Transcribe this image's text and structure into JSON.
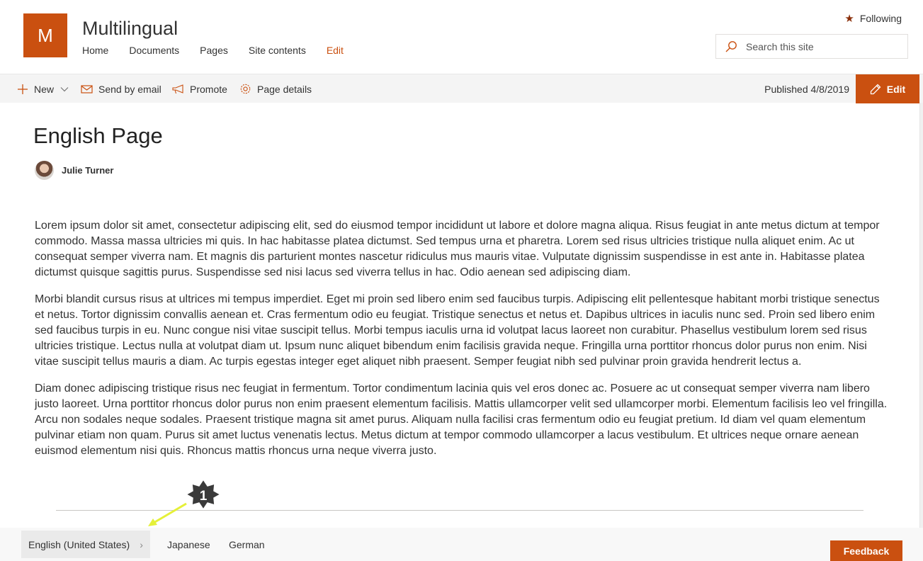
{
  "site": {
    "logo_letter": "M",
    "title": "Multilingual",
    "nav": [
      "Home",
      "Documents",
      "Pages",
      "Site contents"
    ],
    "nav_edit": "Edit",
    "following": "Following",
    "search_placeholder": "Search this site"
  },
  "command_bar": {
    "new": "New",
    "send_by_email": "Send by email",
    "promote": "Promote",
    "page_details": "Page details",
    "published": "Published 4/8/2019",
    "edit": "Edit"
  },
  "page": {
    "title": "English Page",
    "author": "Julie Turner",
    "paragraphs": [
      "Lorem ipsum dolor sit amet, consectetur adipiscing elit, sed do eiusmod tempor incididunt ut labore et dolore magna aliqua. Risus feugiat in ante metus dictum at tempor commodo. Massa massa ultricies mi quis. In hac habitasse platea dictumst. Sed tempus urna et pharetra. Lorem sed risus ultricies tristique nulla aliquet enim. Ac ut consequat semper viverra nam. Et magnis dis parturient montes nascetur ridiculus mus mauris vitae. Vulputate dignissim suspendisse in est ante in. Habitasse platea dictumst quisque sagittis purus. Suspendisse sed nisi lacus sed viverra tellus in hac. Odio aenean sed adipiscing diam.",
      "Morbi blandit cursus risus at ultrices mi tempus imperdiet. Eget mi proin sed libero enim sed faucibus turpis. Adipiscing elit pellentesque habitant morbi tristique senectus et netus. Tortor dignissim convallis aenean et. Cras fermentum odio eu feugiat. Tristique senectus et netus et. Dapibus ultrices in iaculis nunc sed. Proin sed libero enim sed faucibus turpis in eu. Nunc congue nisi vitae suscipit tellus. Morbi tempus iaculis urna id volutpat lacus laoreet non curabitur. Phasellus vestibulum lorem sed risus ultricies tristique. Lectus nulla at volutpat diam ut. Ipsum nunc aliquet bibendum enim facilisis gravida neque. Fringilla urna porttitor rhoncus dolor purus non enim. Nisi vitae suscipit tellus mauris a diam. Ac turpis egestas integer eget aliquet nibh praesent. Semper feugiat nibh sed pulvinar proin gravida hendrerit lectus a.",
      "Diam donec adipiscing tristique risus nec feugiat in fermentum. Tortor condimentum lacinia quis vel eros donec ac. Posuere ac ut consequat semper viverra nam libero justo laoreet. Urna porttitor rhoncus dolor purus non enim praesent elementum facilisis. Mattis ullamcorper velit sed ullamcorper morbi. Elementum facilisis leo vel fringilla. Arcu non sodales neque sodales. Praesent tristique magna sit amet purus. Aliquam nulla facilisi cras fermentum odio eu feugiat pretium. Id diam vel quam elementum pulvinar etiam non quam. Purus sit amet luctus venenatis lectus. Metus dictum at tempor commodo ullamcorper a lacus vestibulum. Et ultrices neque ornare aenean euismod elementum nisi quis. Rhoncus mattis rhoncus urna neque viverra justo."
    ]
  },
  "languages": {
    "current": "English (United States)",
    "others": [
      "Japanese",
      "German"
    ]
  },
  "feedback": "Feedback",
  "annotation": {
    "badge": "1"
  },
  "colors": {
    "accent": "#ca5010",
    "annotation_arrow": "#e5f038"
  }
}
